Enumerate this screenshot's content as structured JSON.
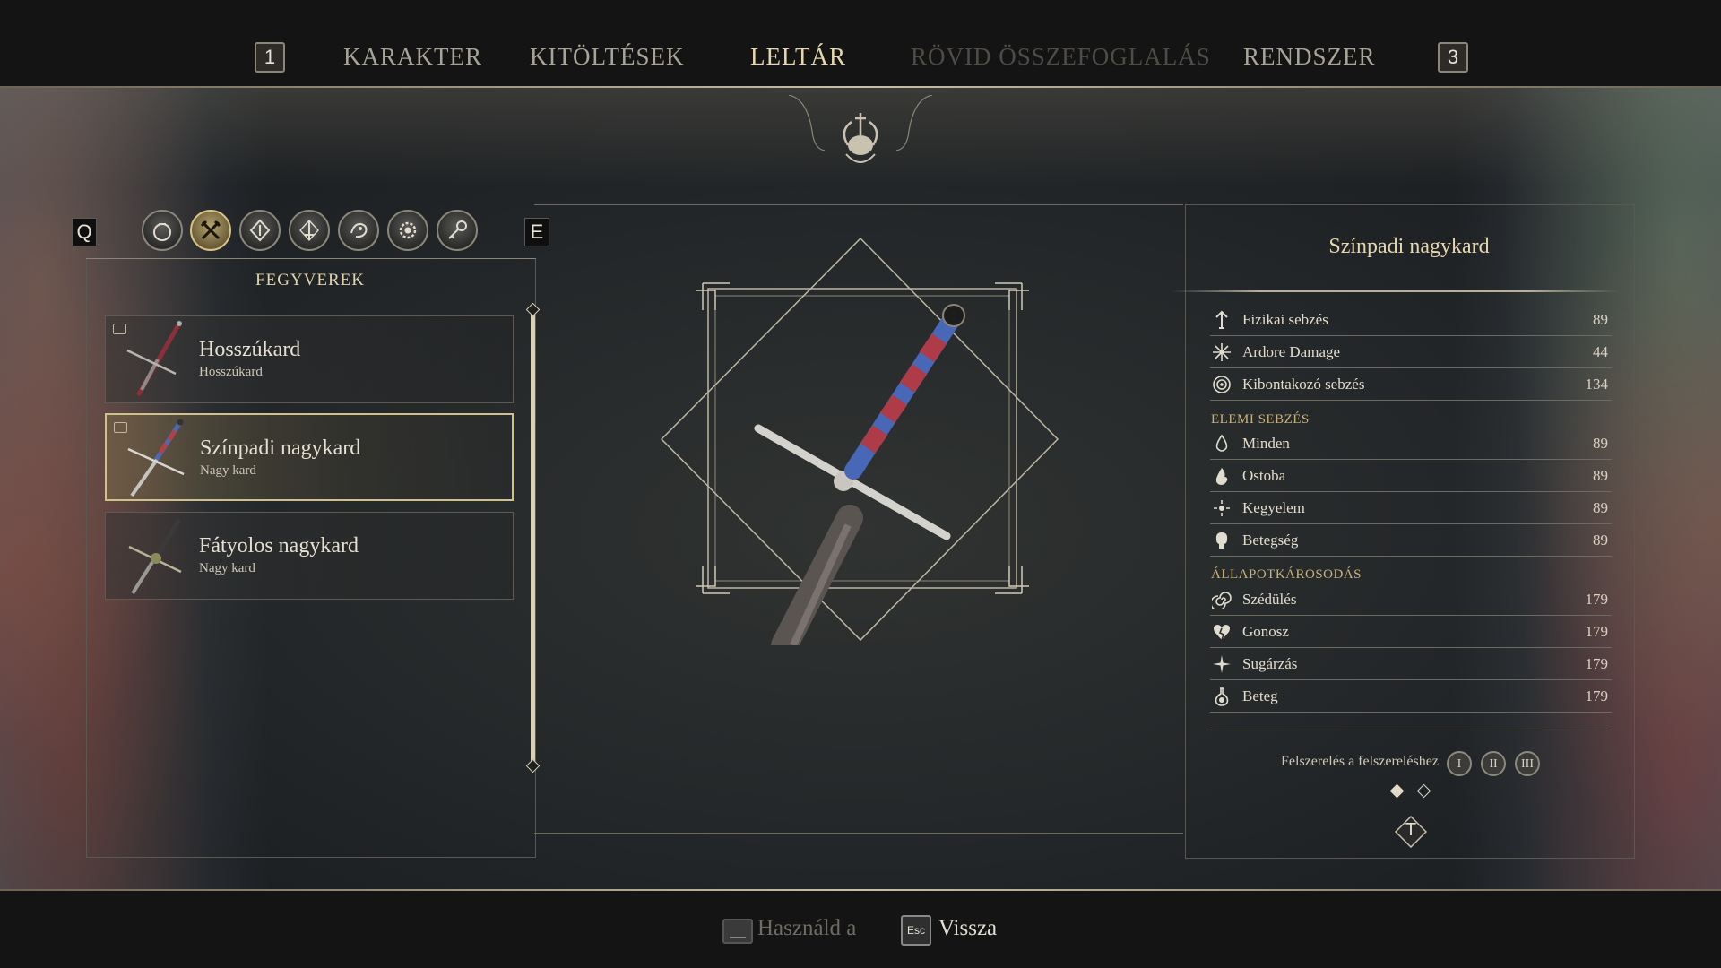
{
  "topbar": {
    "left_key": "1",
    "right_key": "3",
    "tabs": [
      {
        "label": "KARAKTER",
        "state": "normal"
      },
      {
        "label": "KITÖLTÉSEK",
        "state": "normal"
      },
      {
        "label": "LELTÁR",
        "state": "active"
      },
      {
        "label": "RÖVID ÖSSZEFOGLALÁS",
        "state": "disabled"
      },
      {
        "label": "RENDSZER",
        "state": "normal"
      }
    ]
  },
  "inventory": {
    "prev_key": "Q",
    "next_key": "E",
    "categories": [
      {
        "icon": "bag-icon",
        "active": false
      },
      {
        "icon": "crossed-weapons-icon",
        "active": true
      },
      {
        "icon": "shield-icon",
        "active": false
      },
      {
        "icon": "sword-emblem-icon",
        "active": false
      },
      {
        "icon": "creature-icon",
        "active": false
      },
      {
        "icon": "gear-ring-icon",
        "active": false
      },
      {
        "icon": "key-icon",
        "active": false
      }
    ],
    "category_title": "FEGYVEREK",
    "items": [
      {
        "name": "Hosszúkard",
        "type": "Hosszúkard",
        "selected": false
      },
      {
        "name": "Színpadi nagykard",
        "type": "Nagy kard",
        "selected": true
      },
      {
        "name": "Fátyolos nagykard",
        "type": "Nagy kard",
        "selected": false
      }
    ]
  },
  "details": {
    "title": "Színpadi nagykard",
    "base_stats": [
      {
        "icon": "arrow-up-icon",
        "label": "Fizikai sebzés",
        "value": "89"
      },
      {
        "icon": "sparkle-cross-icon",
        "label": "Ardore Damage",
        "value": "44"
      },
      {
        "icon": "concentric-circles-icon",
        "label": "Kibontakozó sebzés",
        "value": "134"
      }
    ],
    "elemental_label": "ELEMI SEBZÉS",
    "elemental_stats": [
      {
        "icon": "drop-icon",
        "label": "Minden",
        "value": "89"
      },
      {
        "icon": "flame-icon",
        "label": "Ostoba",
        "value": "89"
      },
      {
        "icon": "orbit-icon",
        "label": "Kegyelem",
        "value": "89"
      },
      {
        "icon": "skull-icon",
        "label": "Betegség",
        "value": "89"
      }
    ],
    "status_label": "ÁLLAPOTKÁROSODÁS",
    "status_stats": [
      {
        "icon": "spiral-icon",
        "label": "Szédülés",
        "value": "179"
      },
      {
        "icon": "broken-heart-icon",
        "label": "Gonosz",
        "value": "179"
      },
      {
        "icon": "burst-icon",
        "label": "Sugárzás",
        "value": "179"
      },
      {
        "icon": "flask-icon",
        "label": "Beteg",
        "value": "179"
      }
    ],
    "equip_label": "Felszerelés a felszereléshez",
    "equip_slots": [
      "I",
      "II",
      "III"
    ],
    "t_key": "T"
  },
  "bottombar": {
    "use_label": "Használd a",
    "back_key": "Esc",
    "back_label": "Vissza"
  },
  "colors": {
    "accent_gold": "#e6d7ae",
    "selected_border": "#d0c08c",
    "background": "#1d2023"
  }
}
